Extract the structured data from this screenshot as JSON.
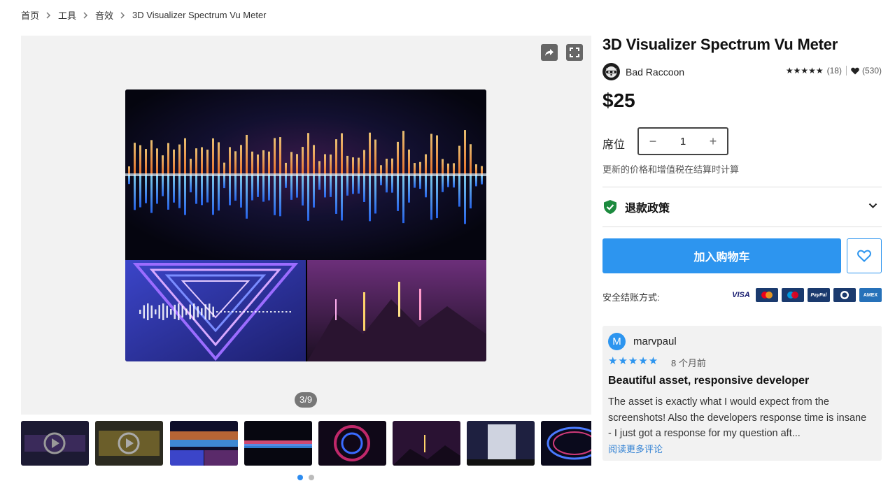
{
  "breadcrumb": {
    "items": [
      "首页",
      "工具",
      "音效",
      "3D Visualizer Spectrum Vu Meter"
    ]
  },
  "gallery": {
    "counter": "3/9",
    "thumb_count": 8,
    "page_dots": 2,
    "active_dot": 0
  },
  "product": {
    "title": "3D Visualizer Spectrum Vu Meter",
    "publisher": "Bad Raccoon",
    "stars": "★★★★★",
    "rating_count": "(18)",
    "favorites": "(530)",
    "price": "$25",
    "seat_label": "席位",
    "quantity": "1",
    "minus": "−",
    "plus": "+",
    "tax_note": "更新的价格和增值税在结算时计算",
    "refund_label": "退款政策",
    "add_to_cart": "加入购物车",
    "secure_checkout": "安全结账方式:",
    "payment_methods": [
      "VISA",
      "Mastercard",
      "Maestro",
      "PayPal",
      "Diners",
      "AMEX"
    ]
  },
  "review": {
    "avatar_letter": "M",
    "user": "marvpaul",
    "stars": "★★★★★",
    "time": "8 个月前",
    "title": "Beautiful asset, responsive developer",
    "body": "The asset is exactly what I would expect from the screenshots! Also the developers response time is insane - I just got a response for my question aft...",
    "read_more": "阅读更多评论"
  },
  "colors": {
    "accent": "#2d95ef",
    "link": "#2d7fd3",
    "refund_shield": "#1c8a3e"
  }
}
